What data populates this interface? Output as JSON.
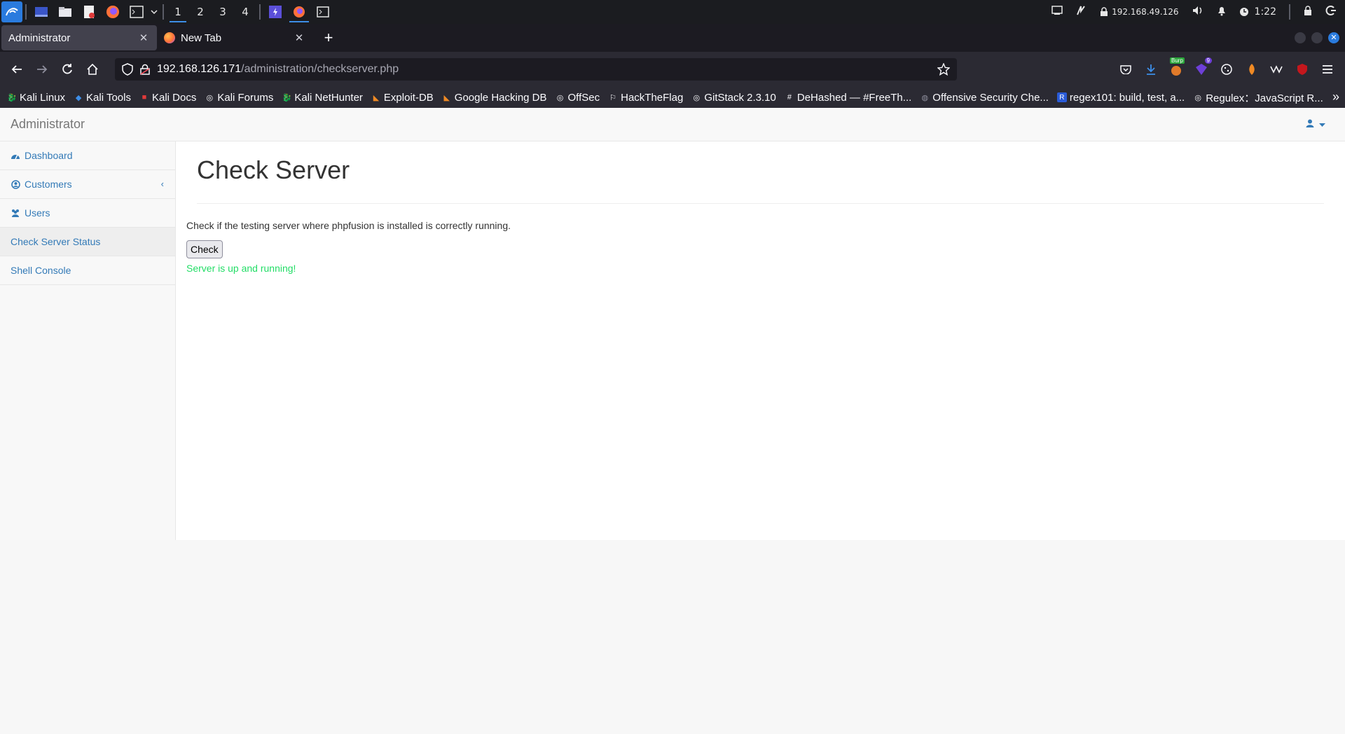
{
  "taskbar": {
    "workspaces": [
      "1",
      "2",
      "3",
      "4"
    ],
    "ip": "192.168.49.126",
    "clock": "1:22"
  },
  "tabs": [
    {
      "title": "Administrator",
      "active": true
    },
    {
      "title": "New Tab",
      "active": false
    }
  ],
  "urlbar": {
    "host": "192.168.126.171",
    "path": "/administration/checkserver.php"
  },
  "extensions": {
    "burp_label": "Burp",
    "badge_count": "9"
  },
  "bookmarks": [
    "Kali Linux",
    "Kali Tools",
    "Kali Docs",
    "Kali Forums",
    "Kali NetHunter",
    "Exploit-DB",
    "Google Hacking DB",
    "OffSec",
    "HackTheFlag",
    "GitStack 2.3.10",
    "DeHashed — #FreeTh...",
    "Offensive Security Che...",
    "regex101: build, test, a...",
    "Regulex：JavaScript R..."
  ],
  "app": {
    "brand": "Administrator",
    "sidebar": [
      {
        "label": "Dashboard",
        "icon": "dashboard-icon"
      },
      {
        "label": "Customers",
        "icon": "user-circle-icon"
      },
      {
        "label": "Users",
        "icon": "users-icon"
      },
      {
        "label": "Check Server Status",
        "icon": ""
      },
      {
        "label": "Shell Console",
        "icon": ""
      }
    ],
    "heading": "Check Server",
    "description": "Check if the testing server where phpfusion is installed is correctly running.",
    "button_label": "Check",
    "status_text": "Server is up and running!",
    "status_color": "#22dd66",
    "link_color": "#337ab7"
  }
}
